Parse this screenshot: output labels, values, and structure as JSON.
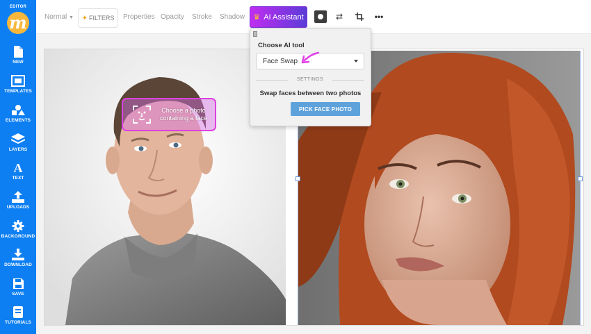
{
  "sidebar": {
    "editor_label": "EDITOR",
    "logo_letter": "m",
    "items": [
      {
        "label": "NEW",
        "icon": "file-icon"
      },
      {
        "label": "TEMPLATES",
        "icon": "templates-icon"
      },
      {
        "label": "ELEMENTS",
        "icon": "elements-icon"
      },
      {
        "label": "LAYERS",
        "icon": "layers-icon"
      },
      {
        "label": "TEXT",
        "icon": "text-icon"
      },
      {
        "label": "UPLOADS",
        "icon": "upload-icon"
      },
      {
        "label": "BACKGROUND",
        "icon": "gear-icon"
      },
      {
        "label": "DOWNLOAD",
        "icon": "download-icon"
      },
      {
        "label": "SAVE",
        "icon": "save-icon"
      },
      {
        "label": "TUTORIALS",
        "icon": "book-icon"
      }
    ]
  },
  "toolbar": {
    "blend_mode": "Normal",
    "filters_label": "FILTERS",
    "properties_label": "Properties",
    "opacity_label": "Opacity",
    "stroke_label": "Stroke",
    "shadow_label": "Shadow",
    "ai_assistant_label": "AI Assistant",
    "icons": [
      "circle-icon",
      "swap-icon",
      "crop-icon",
      "more-icon"
    ]
  },
  "ai_popup": {
    "title": "Choose AI tool",
    "selected_tool": "Face Swap",
    "settings_label": "SETTINGS",
    "description": "Swap faces between two photos",
    "pick_button_label": "PICK FACE PHOTO"
  },
  "canvas": {
    "face_hint_text": "Choose a photo containing a face"
  },
  "colors": {
    "sidebar": "#0d7ff2",
    "logo": "#f6b73c",
    "ai_gradient_start": "#c02ef0",
    "ai_gradient_end": "#5a3cd6",
    "pick_button": "#5ea2dc",
    "hint_border": "#dd41e0"
  }
}
